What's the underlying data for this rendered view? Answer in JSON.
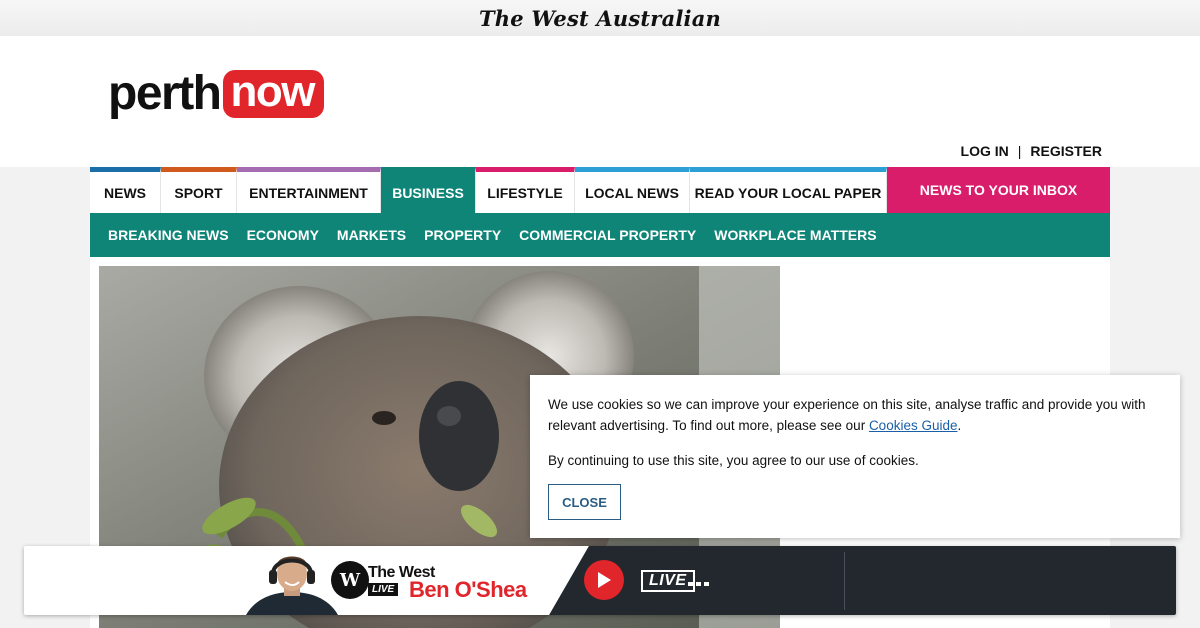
{
  "masthead": {
    "title": "The West Australian"
  },
  "header": {
    "logo": {
      "part1": "perth",
      "part2": "now"
    },
    "auth": {
      "login": "LOG IN",
      "separator": "|",
      "register": "REGISTER"
    }
  },
  "nav": {
    "items": [
      {
        "label": "NEWS",
        "color": "#1b6ea8",
        "width": 71
      },
      {
        "label": "SPORT",
        "color": "#d15a1e",
        "width": 76
      },
      {
        "label": "ENTERTAINMENT",
        "color": "#a46bb0",
        "width": 144
      },
      {
        "label": "BUSINESS",
        "color": "#0f8577",
        "width": 95,
        "active": true
      },
      {
        "label": "LIFESTYLE",
        "color": "#d91d6b",
        "width": 99
      },
      {
        "label": "LOCAL NEWS",
        "color": "#2e9fd4",
        "width": 115
      },
      {
        "label": "READ YOUR LOCAL PAPER",
        "color": "#2e9fd4",
        "width": 197
      }
    ],
    "cta": "NEWS TO YOUR INBOX",
    "sub_items": [
      "BREAKING NEWS",
      "ECONOMY",
      "MARKETS",
      "PROPERTY",
      "COMMERCIAL PROPERTY",
      "WORKPLACE MATTERS"
    ]
  },
  "cookie_banner": {
    "text1": "We use cookies so we can improve your experience on this site, analyse traffic and provide you with relevant advertising. To find out more, please see our ",
    "link": "Cookies Guide",
    "text1_end": ".",
    "text2": "By continuing to use this site, you agree to our use of cookies.",
    "close_label": "CLOSE"
  },
  "player": {
    "brand_line1": "The West",
    "brand_live": "LIVE",
    "host": "Ben O'Shea",
    "live_label": "LIVE",
    "badge": "W"
  }
}
